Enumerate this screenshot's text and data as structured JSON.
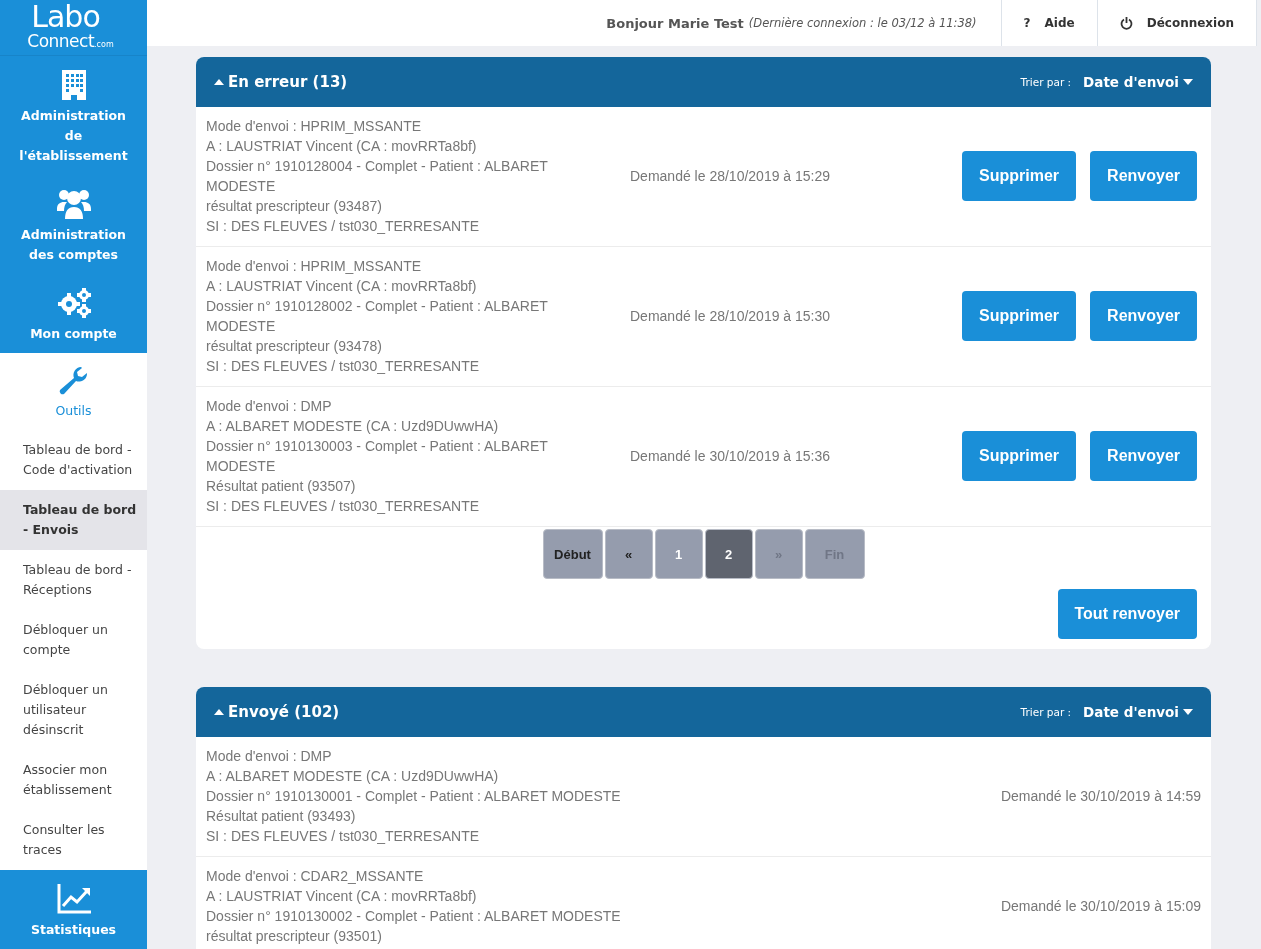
{
  "logo": {
    "line1": "Labo",
    "line2": "Connect",
    "suffix": ".com"
  },
  "sidebar": {
    "items": [
      {
        "label": "Administration de l'établissement",
        "selected": false
      },
      {
        "label": "Administration des comptes",
        "selected": false
      },
      {
        "label": "Mon compte",
        "selected": false
      },
      {
        "label": "Outils",
        "selected": true,
        "children": [
          {
            "label": "Tableau de bord - Code d'activation",
            "selected": false
          },
          {
            "label": "Tableau de bord - Envois",
            "selected": true
          },
          {
            "label": "Tableau de bord - Réceptions",
            "selected": false
          },
          {
            "label": "Débloquer un compte",
            "selected": false
          },
          {
            "label": "Débloquer un utilisateur désinscrit",
            "selected": false
          },
          {
            "label": "Associer mon établissement",
            "selected": false
          },
          {
            "label": "Consulter les traces",
            "selected": false
          }
        ]
      },
      {
        "label": "Statistiques",
        "selected": false
      }
    ]
  },
  "header": {
    "greeting": "Bonjour Marie Test",
    "last_login": "(Dernière connexion : le 03/12 à 11:38)",
    "help_icon": "?",
    "help": "Aide",
    "logout": "Déconnexion"
  },
  "panels": [
    {
      "title": "En erreur (13)",
      "expanded": true,
      "sort_label": "Trier par :",
      "sort_value": "Date d'envoi",
      "rows": [
        {
          "lines": [
            "Mode d'envoi : HPRIM_MSSANTE",
            "A : LAUSTRIAT Vincent (CA : movRRTa8bf)",
            "Dossier n° 1910128004 - Complet - Patient : ALBARET MODESTE",
            "résultat prescripteur (93487)",
            "SI : DES FLEUVES / tst030_TERRESANTE"
          ],
          "date": "Demandé le 28/10/2019 à 15:29",
          "actions": [
            "Supprimer",
            "Renvoyer"
          ]
        },
        {
          "lines": [
            "Mode d'envoi : HPRIM_MSSANTE",
            "A : LAUSTRIAT Vincent (CA : movRRTa8bf)",
            "Dossier n° 1910128002 - Complet - Patient : ALBARET MODESTE",
            "résultat prescripteur (93478)",
            "SI : DES FLEUVES / tst030_TERRESANTE"
          ],
          "date": "Demandé le 28/10/2019 à 15:30",
          "actions": [
            "Supprimer",
            "Renvoyer"
          ]
        },
        {
          "lines": [
            "Mode d'envoi : DMP",
            "A : ALBARET MODESTE (CA : Uzd9DUwwHA)",
            "Dossier n° 1910130003 - Complet - Patient : ALBARET MODESTE",
            "Résultat patient (93507)",
            "SI : DES FLEUVES / tst030_TERRESANTE"
          ],
          "date": "Demandé le 30/10/2019 à 15:36",
          "actions": [
            "Supprimer",
            "Renvoyer"
          ]
        }
      ],
      "pagination": [
        {
          "label": "Début",
          "kind": "nav",
          "selected": false,
          "disabled": false
        },
        {
          "label": "«",
          "kind": "nav",
          "selected": false,
          "disabled": false
        },
        {
          "label": "1",
          "kind": "page",
          "selected": false,
          "disabled": false
        },
        {
          "label": "2",
          "kind": "page",
          "selected": true,
          "disabled": false
        },
        {
          "label": "»",
          "kind": "nav",
          "selected": false,
          "disabled": true
        },
        {
          "label": "Fin",
          "kind": "nav",
          "selected": false,
          "disabled": true
        }
      ],
      "bulk_action": "Tout renvoyer"
    },
    {
      "title": "Envoyé (102)",
      "expanded": true,
      "sort_label": "Trier par :",
      "sort_value": "Date d'envoi",
      "rows": [
        {
          "lines": [
            "Mode d'envoi : DMP",
            "A : ALBARET MODESTE (CA : Uzd9DUwwHA)",
            "Dossier n° 1910130001 - Complet - Patient : ALBARET MODESTE",
            "Résultat patient (93493)",
            "SI : DES FLEUVES / tst030_TERRESANTE"
          ],
          "date": "Demandé le 30/10/2019 à 14:59"
        },
        {
          "lines": [
            "Mode d'envoi : CDAR2_MSSANTE",
            "A : LAUSTRIAT Vincent (CA : movRRTa8bf)",
            "Dossier n° 1910130002 - Complet - Patient : ALBARET MODESTE",
            "résultat prescripteur (93501)"
          ],
          "date": "Demandé le 30/10/2019 à 15:09"
        }
      ]
    }
  ]
}
